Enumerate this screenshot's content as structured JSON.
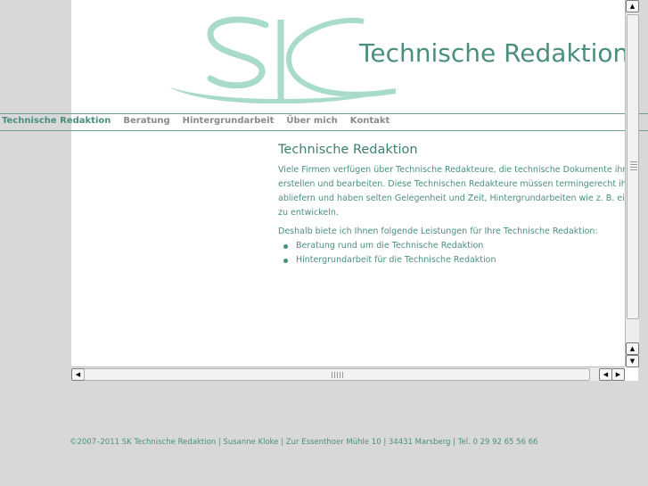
{
  "header": {
    "logo_text": "SK",
    "title": "Technische Redaktion"
  },
  "nav": {
    "items": [
      "Technische Redaktion",
      "Beratung",
      "Hintergrundarbeit",
      "Über mich",
      "Kontakt"
    ],
    "active": "Technische Redaktion"
  },
  "main": {
    "heading": "Technische Redaktion",
    "paragraph1": "Viele Firmen verfügen über Technische Redakteure, die technische Dokumente ihrer Produkte erstellen und bearbeiten. Diese Technischen Redakteure müssen termingerecht ihre Arbeit abliefern und haben selten Gelegenheit und Zeit, Hintergrundarbeiten wie z. B. ein neues Layout zu entwickeln.",
    "paragraph2": "Deshalb biete ich Ihnen folgende Leistungen für Ihre Technische Redaktion:",
    "list": [
      "Beratung rund um die Technische Redaktion",
      "Hintergrundarbeit für die Technische Redaktion"
    ]
  },
  "footer": {
    "text": "©2007–2011 SK Technische Redaktion | Susanne Kloke | Zur Essenthoer Mühle 10 | 34431 Marsberg | Tel. 0 29 92 65 56 66"
  },
  "colors": {
    "accent": "#4a8f7d",
    "logo": "#a9dcc8",
    "nav_inactive": "#8a8a8a",
    "page_background": "#d8d8d8"
  },
  "icons": [
    "arrow-up-icon",
    "arrow-down-icon",
    "arrow-left-icon",
    "arrow-right-icon"
  ]
}
